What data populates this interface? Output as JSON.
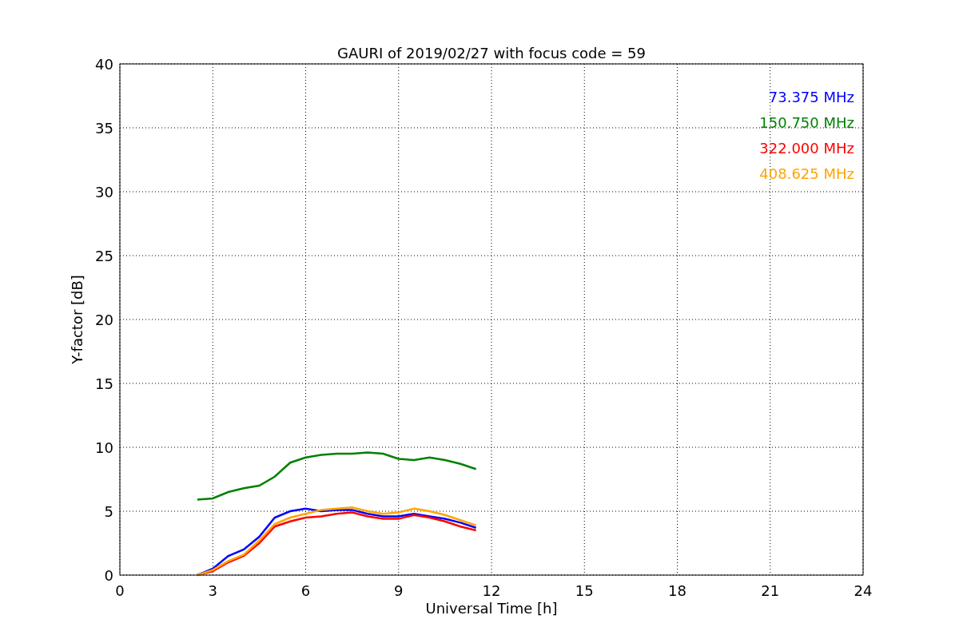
{
  "chart_data": {
    "type": "line",
    "title": "GAURI of 2019/02/27 with focus code = 59",
    "xlabel": "Universal Time [h]",
    "ylabel": "Y-factor [dB]",
    "x": [
      2.5,
      3,
      3.5,
      4,
      4.5,
      5,
      5.5,
      6,
      6.5,
      7,
      7.5,
      8,
      8.5,
      9,
      9.5,
      10,
      10.5,
      11,
      11.5
    ],
    "series": [
      {
        "name": "73.375 MHz",
        "color": "#0000ff",
        "values": [
          0,
          0.5,
          1.5,
          2.0,
          3.0,
          4.5,
          5.0,
          5.2,
          5.0,
          5.1,
          5.1,
          4.8,
          4.6,
          4.6,
          4.8,
          4.6,
          4.4,
          4.1,
          3.7
        ]
      },
      {
        "name": "150.750 MHz",
        "color": "#008000",
        "values": [
          5.9,
          6.0,
          6.5,
          6.8,
          7.0,
          7.7,
          8.8,
          9.2,
          9.4,
          9.5,
          9.5,
          9.6,
          9.5,
          9.1,
          9.0,
          9.2,
          9.0,
          8.7,
          8.3
        ]
      },
      {
        "name": "322.000 MHz",
        "color": "#ff0000",
        "values": [
          0,
          0.3,
          1.0,
          1.5,
          2.5,
          3.8,
          4.2,
          4.5,
          4.6,
          4.8,
          4.9,
          4.6,
          4.4,
          4.4,
          4.7,
          4.5,
          4.2,
          3.8,
          3.5
        ]
      },
      {
        "name": "408.625 MHz",
        "color": "#ffa500",
        "values": [
          0,
          0.4,
          1.1,
          1.6,
          2.7,
          4.0,
          4.5,
          4.8,
          5.1,
          5.2,
          5.3,
          5.0,
          4.8,
          4.9,
          5.2,
          5.0,
          4.7,
          4.3,
          3.9
        ]
      }
    ],
    "grid": true,
    "xlim": [
      0,
      24
    ],
    "ylim": [
      0,
      40
    ],
    "xticks": [
      0,
      3,
      6,
      9,
      12,
      15,
      18,
      21,
      24
    ],
    "yticks": [
      0,
      5,
      10,
      15,
      20,
      25,
      30,
      35,
      40
    ]
  }
}
